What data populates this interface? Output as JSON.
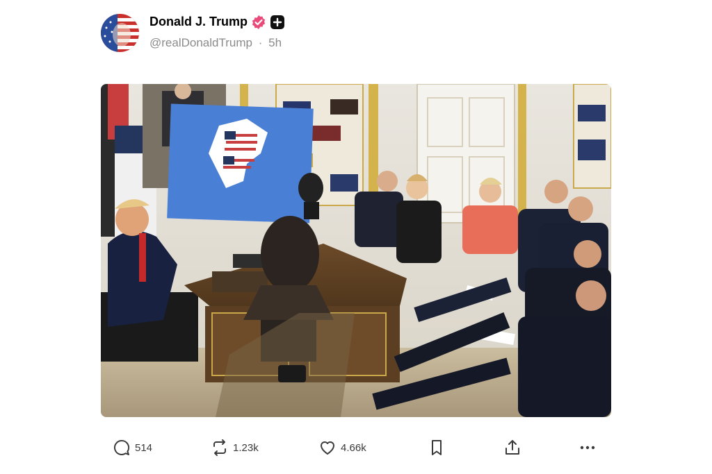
{
  "post": {
    "display_name": "Donald J. Trump",
    "handle": "@realDonaldTrump",
    "separator": "·",
    "time": "5h",
    "avatar_icon": "flag-face-avatar",
    "verified_icon": "verified-badge-icon",
    "verified_color": "#e84b7a",
    "plus_icon": "plus-badge-icon"
  },
  "media": {
    "description_icon": "photo",
    "map_color": "#4a7fd6"
  },
  "actions": {
    "reply": {
      "icon": "reply-icon",
      "count": "514"
    },
    "repost": {
      "icon": "repost-icon",
      "count": "1.23k"
    },
    "like": {
      "icon": "heart-icon",
      "count": "4.66k"
    },
    "bookmark": {
      "icon": "bookmark-icon"
    },
    "share": {
      "icon": "share-icon"
    },
    "more": {
      "icon": "more-icon"
    }
  }
}
